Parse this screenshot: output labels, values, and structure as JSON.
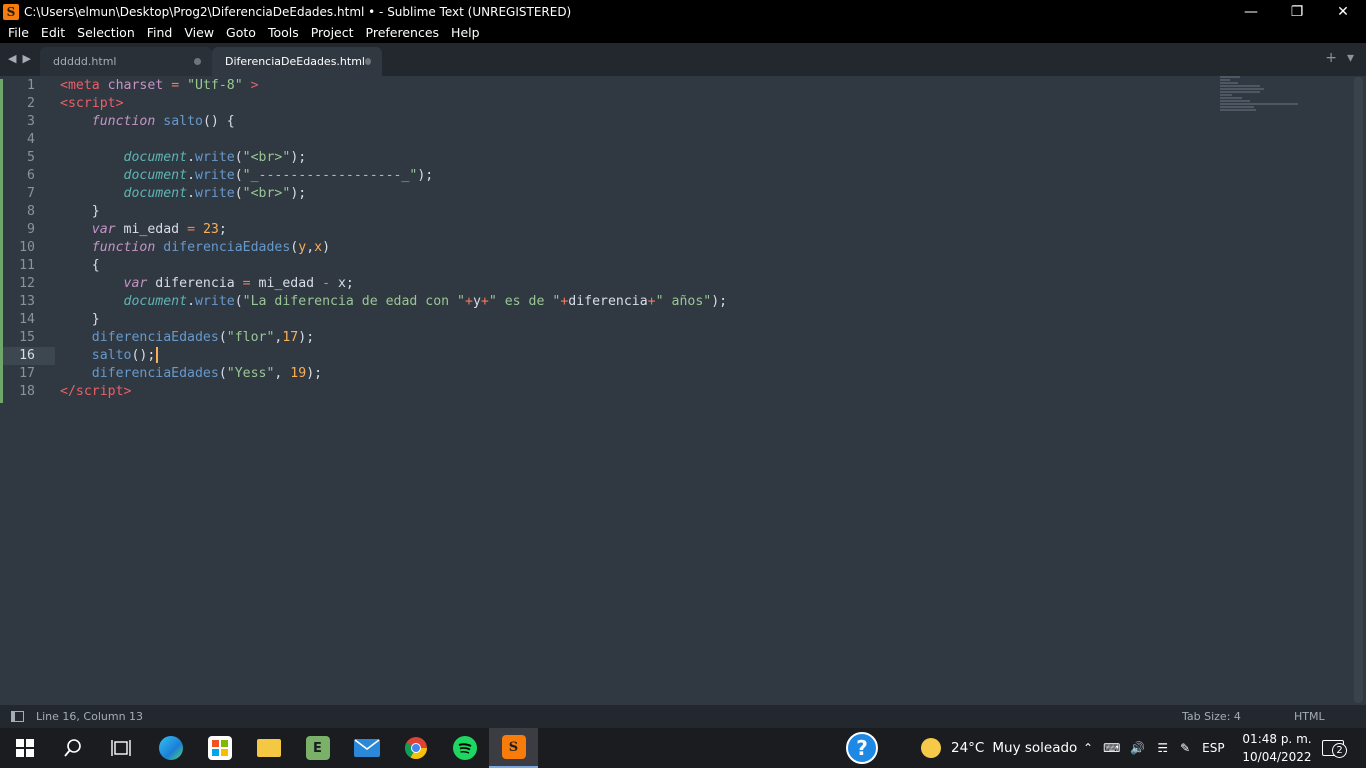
{
  "window": {
    "title": "C:\\Users\\elmun\\Desktop\\Prog2\\DiferenciaDeEdades.html • - Sublime Text (UNREGISTERED)",
    "app_icon": "sublime-text-icon"
  },
  "menu": [
    "File",
    "Edit",
    "Selection",
    "Find",
    "View",
    "Goto",
    "Tools",
    "Project",
    "Preferences",
    "Help"
  ],
  "tabs": [
    {
      "label": "ddddd.html",
      "active": false
    },
    {
      "label": "DiferenciaDeEdades.html",
      "active": true
    }
  ],
  "editor": {
    "current_line": 16,
    "line_numbers": [
      "1",
      "2",
      "3",
      "4",
      "5",
      "6",
      "7",
      "8",
      "9",
      "10",
      "11",
      "12",
      "13",
      "14",
      "15",
      "16",
      "17",
      "18"
    ],
    "theme_colors": {
      "background": "#303841",
      "tag": "#ec5f67",
      "string": "#99c794",
      "keyword": "#c594c5",
      "function": "#6699cc",
      "number": "#f9ae58"
    }
  },
  "status": {
    "position": "Line 16, Column 13",
    "tab_size": "Tab Size: 4",
    "syntax": "HTML"
  },
  "taskbar": {
    "apps": [
      "windows-start-icon",
      "search-icon",
      "task-view-icon",
      "edge-icon",
      "store-icon",
      "file-explorer-icon",
      "evernote-icon",
      "mail-icon",
      "chrome-icon",
      "spotify-icon",
      "sublime-text-icon"
    ],
    "weather_temp": "24°C",
    "weather_desc": "Muy soleado",
    "language": "ESP",
    "time": "01:48 p. m.",
    "date": "10/04/2022",
    "notifications": "2"
  }
}
